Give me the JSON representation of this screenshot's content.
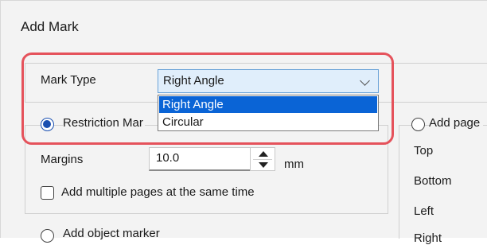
{
  "dialog": {
    "title": "Add Mark"
  },
  "mark_type": {
    "label": "Mark Type",
    "selected": "Right Angle",
    "options": [
      "Right Angle",
      "Circular"
    ]
  },
  "restriction": {
    "radio_label": "Restriction Mar",
    "margins_label": "Margins",
    "margins_value": "10.0",
    "unit": "mm",
    "multi_pages_label": "Add multiple pages at the same time"
  },
  "object_marker": {
    "radio_label": "Add object marker"
  },
  "add_page": {
    "radio_label": "Add page",
    "top": "Top",
    "bottom": "Bottom",
    "left": "Left",
    "right": "Right"
  },
  "colors": {
    "highlight": "#e5525b",
    "selection": "#0a64d6",
    "dropdown_bg": "#e0eefb",
    "radio_selected": "#1a4fb0"
  },
  "icons": {
    "dropdown": "chevron-down-icon",
    "spinner_up": "triangle-up-icon",
    "spinner_down": "triangle-down-icon"
  }
}
